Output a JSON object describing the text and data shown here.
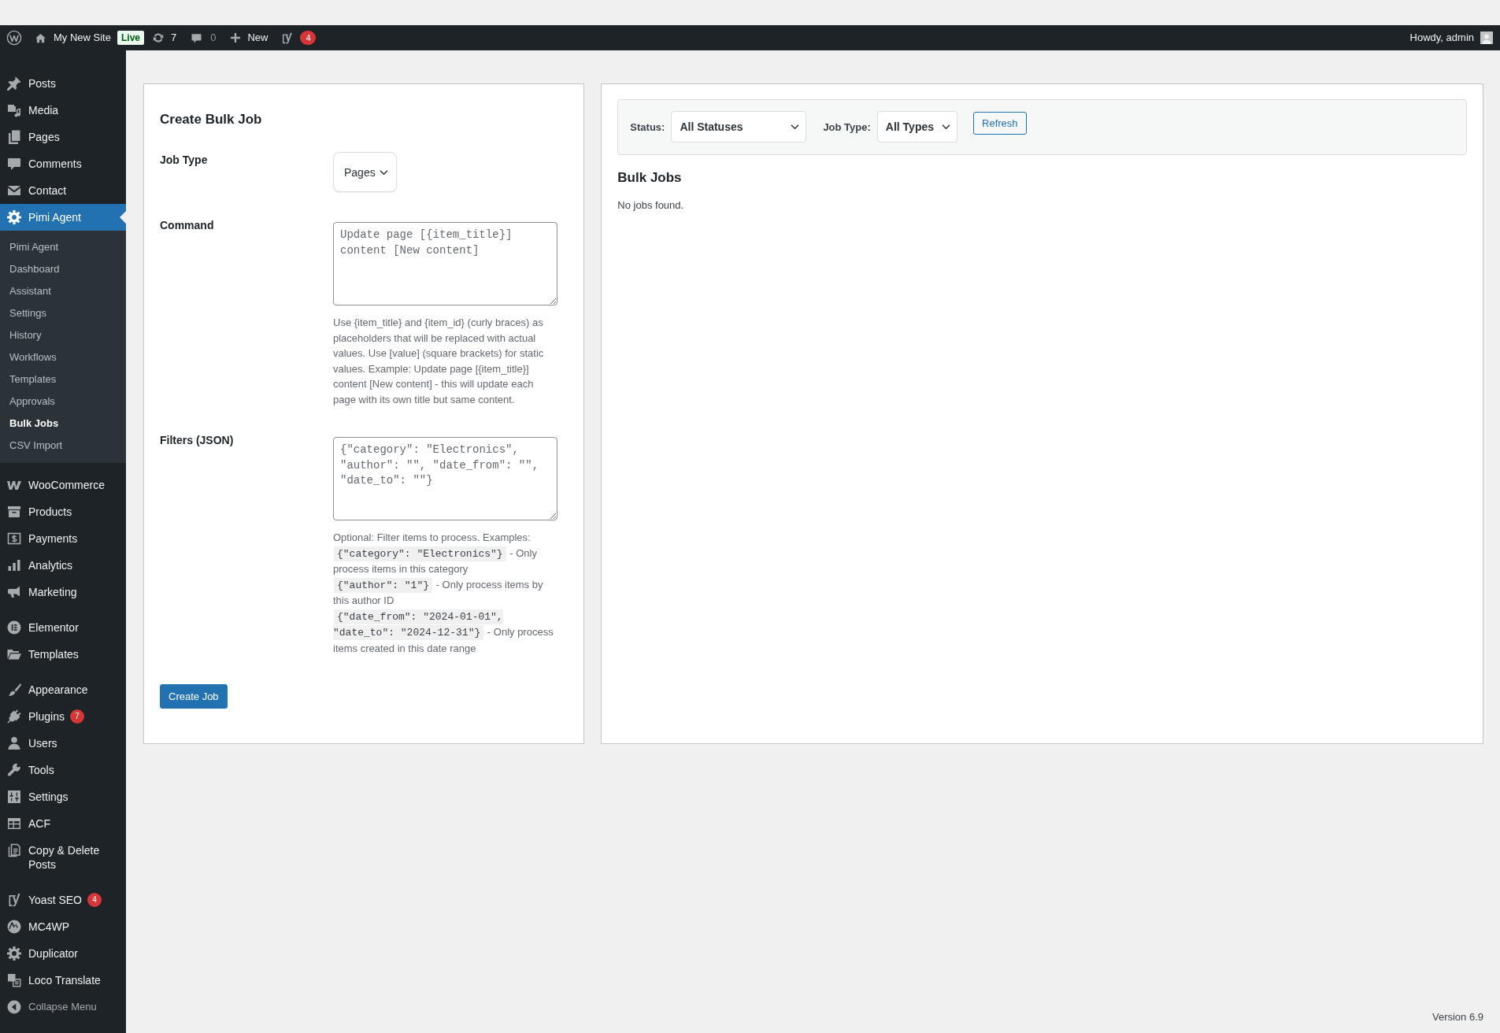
{
  "admin_bar": {
    "site_name": "My New Site",
    "live_badge": "Live",
    "updates_count": "7",
    "comments_count": "0",
    "new_label": "New",
    "seo_count": "4",
    "greeting": "Howdy, admin"
  },
  "sidebar": {
    "groups": [
      [
        {
          "label": "Posts",
          "selected": false
        },
        {
          "label": "Media",
          "selected": false
        },
        {
          "label": "Pages",
          "selected": false
        },
        {
          "label": "Comments",
          "selected": false
        },
        {
          "label": "Contact",
          "selected": false
        },
        {
          "label": "Pimi Agent",
          "selected": true,
          "children": [
            {
              "label": "Pimi Agent",
              "selected": false
            },
            {
              "label": "Dashboard",
              "selected": false
            },
            {
              "label": "Assistant",
              "selected": false
            },
            {
              "label": "Settings",
              "selected": false
            },
            {
              "label": "History",
              "selected": false
            },
            {
              "label": "Workflows",
              "selected": false
            },
            {
              "label": "Templates",
              "selected": false
            },
            {
              "label": "Approvals",
              "selected": false
            },
            {
              "label": "Bulk Jobs",
              "selected": true
            },
            {
              "label": "CSV Import",
              "selected": false
            }
          ]
        }
      ],
      [
        {
          "label": "WooCommerce",
          "selected": false
        },
        {
          "label": "Products",
          "selected": false
        },
        {
          "label": "Payments",
          "selected": false
        },
        {
          "label": "Analytics",
          "selected": false
        },
        {
          "label": "Marketing",
          "selected": false
        }
      ],
      [
        {
          "label": "Elementor",
          "selected": false
        },
        {
          "label": "Templates",
          "selected": false
        }
      ],
      [
        {
          "label": "Appearance",
          "selected": false
        },
        {
          "label": "Plugins",
          "selected": false,
          "badge": "7"
        },
        {
          "label": "Users",
          "selected": false
        },
        {
          "label": "Tools",
          "selected": false
        },
        {
          "label": "Settings",
          "selected": false
        },
        {
          "label": "ACF",
          "selected": false
        },
        {
          "label": "Copy & Delete Posts",
          "selected": false
        }
      ],
      [
        {
          "label": "Yoast SEO",
          "selected": false,
          "badge": "4"
        },
        {
          "label": "MC4WP",
          "selected": false
        },
        {
          "label": "Duplicator",
          "selected": false
        },
        {
          "label": "Loco Translate",
          "selected": false
        }
      ]
    ],
    "collapse_label": "Collapse Menu"
  },
  "create_job": {
    "title": "Create Bulk Job",
    "fields": [
      {
        "kind": "select",
        "label": "Job Type",
        "value": "Pages"
      },
      {
        "kind": "textarea",
        "label": "Command",
        "placeholder": "Update page [{item_title}] content [New content]",
        "help": "Use {item_title} and {item_id} (curly braces) as placeholders that will be replaced with actual values. Use [value] (square brackets) for static values. Example: Update page [{item_title}] content [New content] - this will update each page with its own title but same content."
      },
      {
        "kind": "textarea",
        "label": "Filters (JSON)",
        "placeholder": "{\"category\": \"Electronics\", \"author\": \"\", \"date_from\": \"\", \"date_to\": \"\"}",
        "help": "Optional: Filter items to process. Examples:",
        "examples": [
          {
            "code": "{\"category\": \"Electronics\"}",
            "text": "- Only process items in this category"
          },
          {
            "code": "{\"author\": \"1\"}",
            "text": "- Only process items by this author ID"
          },
          {
            "code": "{\"date_from\": \"2024-01-01\", \"date_to\": \"2024-12-31\"}",
            "text": "- Only process items created in this date range"
          }
        ]
      }
    ],
    "submit_label": "Create Job"
  },
  "jobs_panel": {
    "filters": [
      {
        "label": "Status:",
        "value": "All Statuses"
      },
      {
        "label": "Job Type:",
        "value": "All Types"
      }
    ],
    "refresh_label": "Refresh",
    "title": "Bulk Jobs",
    "empty_message": "No jobs found."
  },
  "footer": {
    "version": "Version 6.9"
  }
}
